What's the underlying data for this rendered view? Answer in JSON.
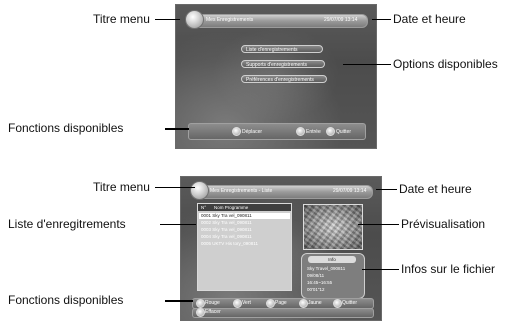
{
  "callouts": {
    "top_title_menu": "Titre menu",
    "top_date_heure": "Date et heure",
    "top_options": "Options disponibles",
    "top_fonctions": "Fonctions disponibles",
    "bottom_title_menu": "Titre menu",
    "bottom_date_heure": "Date et heure",
    "bottom_liste": "Liste d'enregitrements",
    "bottom_previsualisation": "Prévisualisation",
    "bottom_infos": "Infos sur le fichier",
    "bottom_fonctions": "Fonctions disponibles"
  },
  "screen1": {
    "title": "Mes Enregistrements",
    "datetime": "29/07/09  13:14",
    "options": [
      "Liste d'enregistrements",
      "Supports d'enregistrements",
      "Préférences d'enregistrements"
    ],
    "functions": [
      {
        "label": "Déplacer"
      },
      {
        "label": "Entrée"
      },
      {
        "label": "Quitter"
      }
    ]
  },
  "screen2": {
    "title": "Mes Enregistrements - Liste",
    "datetime": "29/07/09  13:14",
    "list_header": {
      "col1": "N°",
      "col2": "Nom Programme"
    },
    "rows": [
      {
        "no": "0001",
        "name": "Sky  Tra vel_090811"
      },
      {
        "no": "0002",
        "name": "Sky  Tra vel_090811"
      },
      {
        "no": "0003",
        "name": "Sky  Tra vel_090811"
      },
      {
        "no": "0004",
        "name": "Sky  Tra vel_090811"
      },
      {
        "no": "0005",
        "name": "UKTV  His tory_090811"
      }
    ],
    "info": {
      "title": "Info",
      "lines": [
        "Sky Travel_090811",
        "09/08/11",
        "16:45~16:55",
        "00'01\"12"
      ]
    },
    "functions": [
      {
        "label": "Rouge"
      },
      {
        "label": "Vert"
      },
      {
        "label": "Page"
      },
      {
        "label": "Jaune"
      },
      {
        "label": "Quitter"
      },
      {
        "label": "Effacer"
      }
    ]
  }
}
